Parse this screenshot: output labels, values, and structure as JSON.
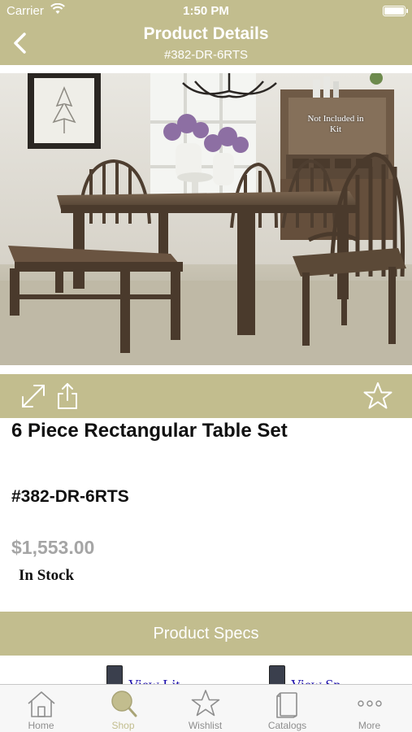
{
  "status_bar": {
    "carrier": "Carrier",
    "time": "1:50 PM"
  },
  "nav": {
    "title": "Product Details",
    "subtitle": "#382-DR-6RTS"
  },
  "photo": {
    "overlay_note": "Not Included in Kit"
  },
  "product": {
    "name": "6 Piece Rectangular Table Set",
    "sku": "#382-DR-6RTS",
    "price": "$1,553.00",
    "stock": "In Stock"
  },
  "specs": {
    "label": "Product Specs"
  },
  "links": [
    {
      "label": "View Lit..."
    },
    {
      "label": "View Sp..."
    }
  ],
  "tabs": [
    {
      "label": "Home",
      "icon": "home-icon"
    },
    {
      "label": "Shop",
      "icon": "search-icon"
    },
    {
      "label": "Wishlist",
      "icon": "star-icon"
    },
    {
      "label": "Catalogs",
      "icon": "book-icon"
    },
    {
      "label": "More",
      "icon": "more-icon"
    }
  ],
  "colors": {
    "accent": "#c2bd8e",
    "price": "#a5a5a5",
    "tab_inactive": "#8e8e8e"
  }
}
